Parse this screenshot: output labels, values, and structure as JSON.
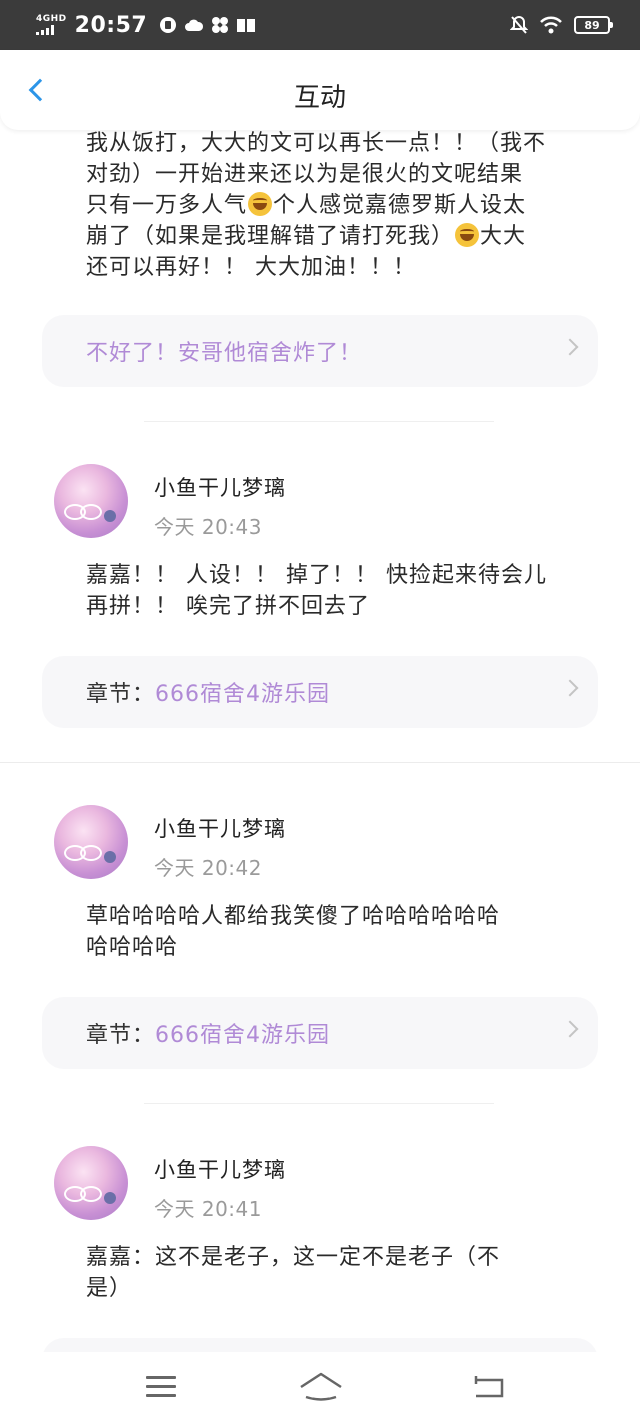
{
  "status_bar": {
    "network": "4GHD",
    "time": "20:57",
    "battery": "89"
  },
  "header": {
    "title": "互动"
  },
  "top_comment": {
    "lines": [
      "我从饭打，大大的文可以再长一点！！（我不",
      "对劲）一开始进来还以为是很火的文呢结果",
      "只有一万多人气",
      "个人感觉嘉德罗斯人设太",
      "崩了（如果是我理解错了请打死我）",
      "大大",
      "还可以再好！！ 大大加油！！！"
    ],
    "chapter_title": "不好了！安哥他宿舍炸了！"
  },
  "comments": [
    {
      "username": "小鱼干儿梦璃",
      "time": "今天 20:43",
      "lines": [
        "嘉嘉！！ 人设！！ 掉了！！ 快捡起来待会儿",
        "再拼！！ 唉完了拼不回去了"
      ],
      "chapter_prefix": "章节：",
      "chapter_title": "666宿舍4游乐园"
    },
    {
      "username": "小鱼干儿梦璃",
      "time": "今天 20:42",
      "lines": [
        "草哈哈哈哈人都给我笑傻了哈哈哈哈哈哈",
        "哈哈哈哈"
      ],
      "chapter_prefix": "章节：",
      "chapter_title": "666宿舍4游乐园"
    },
    {
      "username": "小鱼干儿梦璃",
      "time": "今天 20:41",
      "lines": [
        "嘉嘉：这不是老子，这一定不是老子（不",
        "是）"
      ]
    }
  ],
  "colors": {
    "accent_blue": "#2c95e8",
    "chapter_link": "#b08ad6",
    "status_bar_bg": "#3b3b3b"
  }
}
